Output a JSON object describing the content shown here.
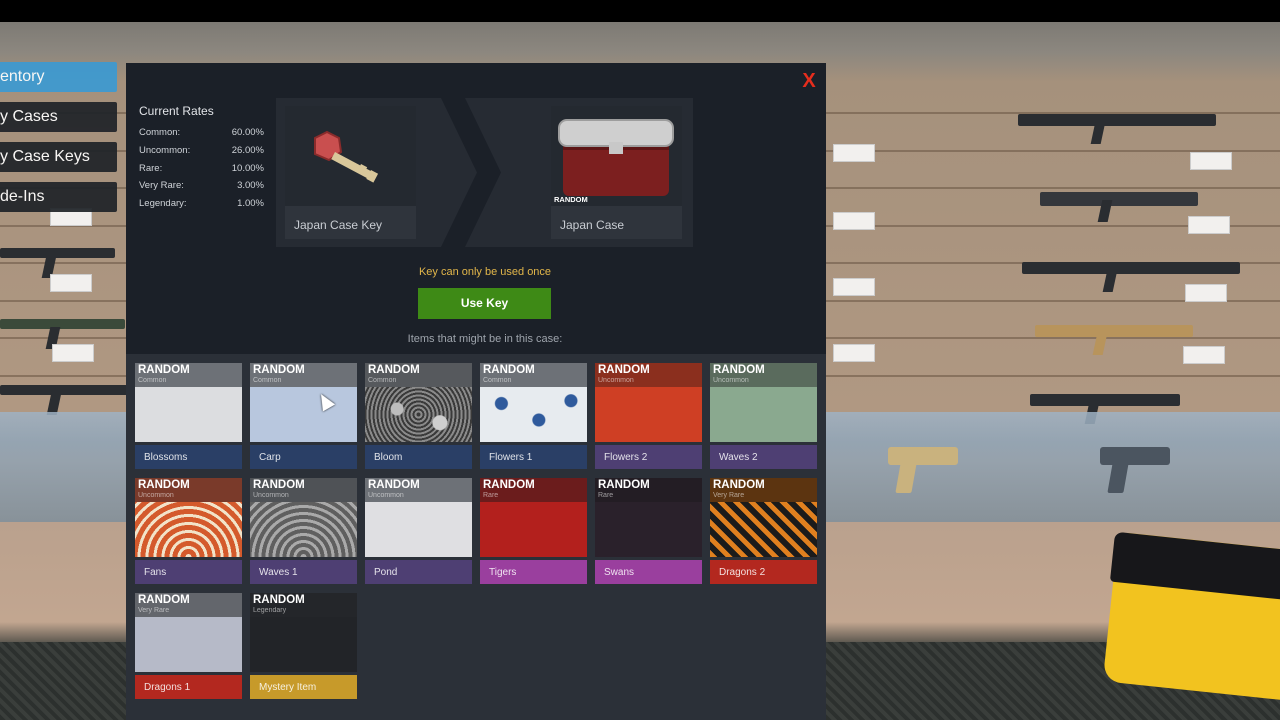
{
  "menu": {
    "tabs": [
      {
        "label": "entory",
        "active": true
      },
      {
        "label": "y Cases",
        "active": false
      },
      {
        "label": "y Case Keys",
        "active": false
      },
      {
        "label": "de-Ins",
        "active": false
      }
    ]
  },
  "modal": {
    "close_label": "X",
    "rates": {
      "title": "Current Rates",
      "rows": [
        {
          "label": "Common:",
          "value": "60.00%"
        },
        {
          "label": "Uncommon:",
          "value": "26.00%"
        },
        {
          "label": "Rare:",
          "value": "10.00%"
        },
        {
          "label": "Very Rare:",
          "value": "3.00%"
        },
        {
          "label": "Legendary:",
          "value": "1.00%"
        }
      ]
    },
    "key_slot": {
      "label": "Japan Case Key",
      "icon": "key-icon"
    },
    "case_slot": {
      "label": "Japan Case",
      "tag": "RANDOM",
      "icon": "crate-icon"
    },
    "key_note": "Key can only be used once",
    "use_key_label": "Use Key",
    "items_note": "Items that might be in this case:",
    "colors": {
      "accent_green": "#3e8a16",
      "note_gold": "#e2b64a",
      "close_red": "#e52d1d"
    },
    "items": [
      {
        "random": "RANDOM",
        "rarity": "Common",
        "name": "Blossoms",
        "head": "#6d7177",
        "pattern": "#dcdde0",
        "foot": "#2a3f66"
      },
      {
        "random": "RANDOM",
        "rarity": "Common",
        "name": "Carp",
        "head": "#6d7177",
        "pattern": "#b8c7de",
        "foot": "#2a3f66"
      },
      {
        "random": "RANDOM",
        "rarity": "Common",
        "name": "Bloom",
        "head": "#56595d",
        "pattern": "bloom",
        "foot": "#2a3f66"
      },
      {
        "random": "RANDOM",
        "rarity": "Common",
        "name": "Flowers 1",
        "head": "#6d7177",
        "pattern": "flowers1",
        "foot": "#2a3f66"
      },
      {
        "random": "RANDOM",
        "rarity": "Uncommon",
        "name": "Flowers 2",
        "head": "#8b2f1e",
        "pattern": "#cf3f24",
        "foot": "#4e3f73"
      },
      {
        "random": "RANDOM",
        "rarity": "Uncommon",
        "name": "Waves 2",
        "head": "#5a6b5d",
        "pattern": "#8aa98f",
        "foot": "#4e3f73"
      },
      {
        "random": "RANDOM",
        "rarity": "Uncommon",
        "name": "Fans",
        "head": "#7a3a2a",
        "pattern": "fans",
        "foot": "#4e3f73"
      },
      {
        "random": "RANDOM",
        "rarity": "Uncommon",
        "name": "Waves 1",
        "head": "#4f5256",
        "pattern": "waves1",
        "foot": "#4e3f73"
      },
      {
        "random": "RANDOM",
        "rarity": "Uncommon",
        "name": "Pond",
        "head": "#6d7177",
        "pattern": "#dfdfe2",
        "foot": "#4e3f73"
      },
      {
        "random": "RANDOM",
        "rarity": "Rare",
        "name": "Tigers",
        "head": "#6b1c1c",
        "pattern": "#b3201d",
        "foot": "#9a3f9e"
      },
      {
        "random": "RANDOM",
        "rarity": "Rare",
        "name": "Swans",
        "head": "#231d24",
        "pattern": "#2a212b",
        "foot": "#9a3f9e"
      },
      {
        "random": "RANDOM",
        "rarity": "Very Rare",
        "name": "Dragons 2",
        "head": "#5c3410",
        "pattern": "dragons",
        "foot": "#b3281f"
      },
      {
        "random": "RANDOM",
        "rarity": "Very Rare",
        "name": "Dragons 1",
        "head": "#63666c",
        "pattern": "#b6bac8",
        "foot": "#b3281f"
      },
      {
        "random": "RANDOM",
        "rarity": "Legendary",
        "name": "Mystery Item",
        "head": "#24262a",
        "pattern": "#222428",
        "foot": "#c79a2a"
      }
    ]
  }
}
